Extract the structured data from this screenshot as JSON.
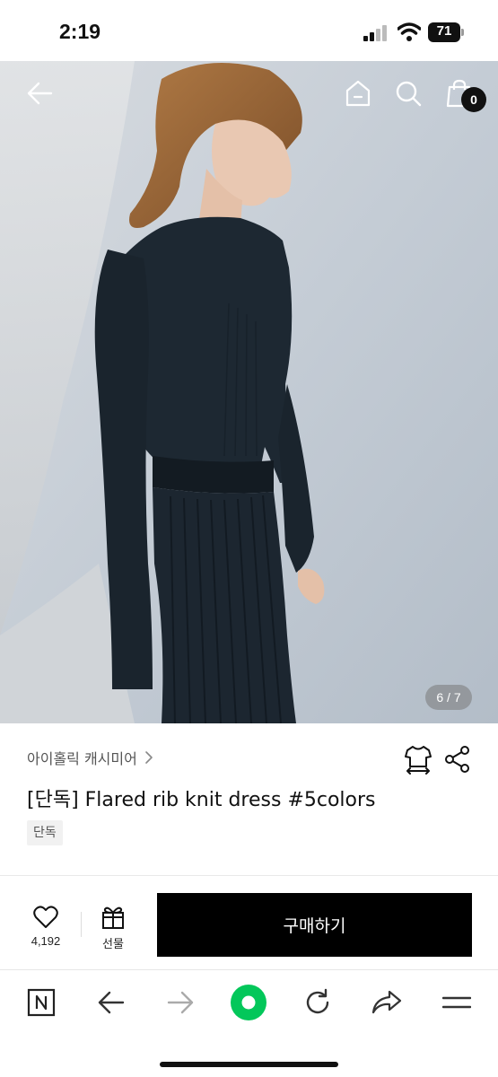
{
  "status_bar": {
    "time": "2:19",
    "battery": "71"
  },
  "hero": {
    "page_indicator": "6 / 7",
    "cart_count": "0"
  },
  "product": {
    "brand": "아이홀릭 캐시미어",
    "title": "[단독] Flared rib knit dress #5colors",
    "tag": "단독"
  },
  "actions": {
    "like_count": "4,192",
    "gift_label": "선물",
    "buy_label": "구매하기"
  },
  "browser_nav": {
    "items": [
      "naver-icon",
      "back-arrow-icon",
      "forward-arrow-icon",
      "green-dot-icon",
      "refresh-icon",
      "share-icon",
      "menu-icon"
    ]
  },
  "colors": {
    "accent_green": "#03c75a",
    "buy_button": "#000000"
  }
}
